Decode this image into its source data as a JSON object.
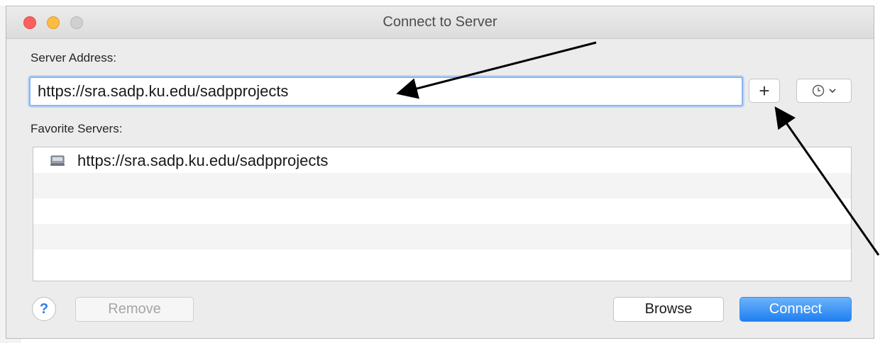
{
  "window": {
    "title": "Connect to Server"
  },
  "server_address": {
    "label": "Server Address:",
    "value": "https://sra.sadp.ku.edu/sadpprojects"
  },
  "add_favorite": {
    "label": "+"
  },
  "recent_servers": {
    "icon": "clock-icon"
  },
  "favorites": {
    "label": "Favorite Servers:",
    "items": [
      {
        "label": "https://sra.sadp.ku.edu/sadpprojects",
        "icon": "server-icon"
      }
    ]
  },
  "buttons": {
    "help": "?",
    "remove": "Remove",
    "browse": "Browse",
    "connect": "Connect"
  },
  "colors": {
    "accent": "#1f7ff0",
    "close": "#fc605c",
    "minimize": "#fdbc40"
  }
}
